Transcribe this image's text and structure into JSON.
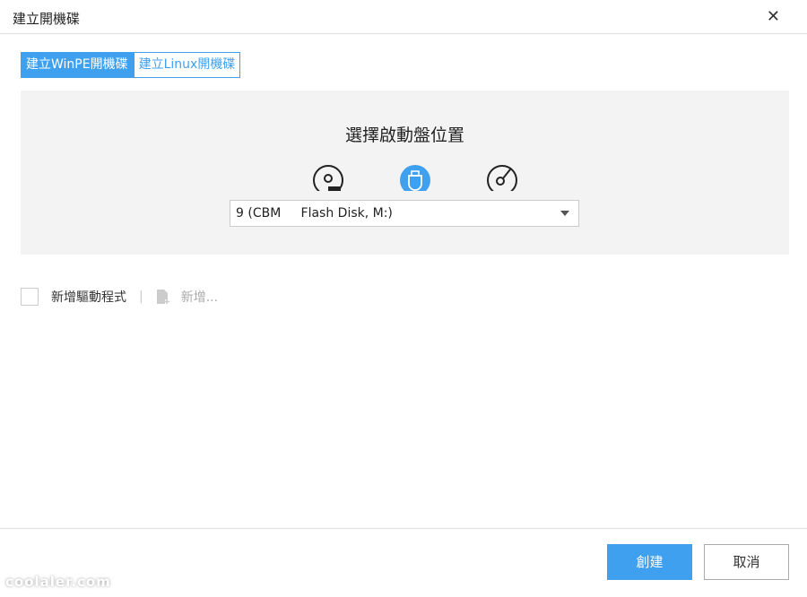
{
  "window": {
    "title": "建立開機碟",
    "close_icon": "close-icon"
  },
  "tabs": [
    {
      "label": "建立WinPE開機碟",
      "active": true
    },
    {
      "label": "建立Linux開機碟",
      "active": false
    }
  ],
  "panel": {
    "heading": "選擇啟動盤位置",
    "media_options": [
      {
        "icon": "hard-disk-icon",
        "selected": false
      },
      {
        "icon": "usb-drive-icon",
        "selected": true
      },
      {
        "icon": "cd-disc-icon",
        "selected": false
      }
    ],
    "device_select": {
      "value": "9 (CBM     Flash Disk, M:)"
    }
  },
  "driver": {
    "checkbox_label": "新增驅動程式",
    "checked": false,
    "separator": "|",
    "add_label": "新增..."
  },
  "footer": {
    "create_label": "創建",
    "cancel_label": "取消"
  },
  "watermark": "coolaler.com",
  "colors": {
    "accent": "#3fa0ef",
    "panel_bg": "#f3f3f3"
  }
}
